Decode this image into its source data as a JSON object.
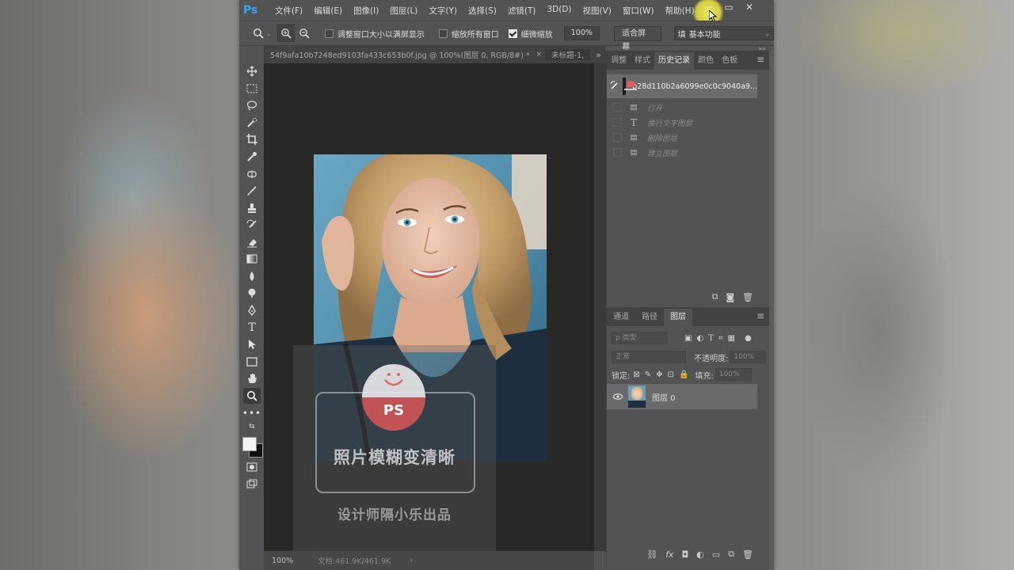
{
  "app": {
    "logo": "Ps",
    "menu": [
      "文件(F)",
      "编辑(E)",
      "图像(I)",
      "图层(L)",
      "文字(Y)",
      "选择(S)",
      "滤镜(T)",
      "3D(D)",
      "视图(V)",
      "窗口(W)",
      "帮助(H)"
    ],
    "window_controls": [
      "—",
      "▭",
      "✕"
    ]
  },
  "options": {
    "resize_windows_label": "调整窗口大小以满屏显示",
    "zoom_all_label": "缩放所有窗口",
    "scrubby_zoom_label": "细微缩放",
    "zoom_value": "100%",
    "fit_screen_button": "适合屏幕",
    "workspace_prefix": "填",
    "workspace_value": "基本功能",
    "resize_windows_checked": false,
    "zoom_all_checked": false,
    "scrubby_zoom_checked": true
  },
  "document": {
    "tab_title": "54f9afa10b7248ed9103fa433c653b0f.jpg @ 100%(图层 0, RGB/8#) *",
    "tab_close": "×",
    "second_tab": "未标题-1,",
    "overflow": "»",
    "zoom_status": "100%",
    "doc_status": "文档:461.9K/461.9K"
  },
  "watermark": {
    "badge_text": "PS",
    "title": "照片模糊变清晰",
    "subtitle": "设计师隔小乐出品"
  },
  "history_panel": {
    "tabs": [
      "调整",
      "样式",
      "历史记录",
      "颜色",
      "色板"
    ],
    "active_tab": 2,
    "snapshot_label": "b28d110b2a6099e0c0c9040a9...",
    "items": [
      {
        "icon": "document-icon",
        "label": "打开"
      },
      {
        "icon": "text-icon",
        "label": "换行文字图层"
      },
      {
        "icon": "document-icon",
        "label": "删除图层"
      },
      {
        "icon": "document-icon",
        "label": "建立图层"
      }
    ]
  },
  "layers_panel": {
    "tabs": [
      "通道",
      "路径",
      "图层"
    ],
    "active_tab": 2,
    "filter_placeholder": "ρ 类型",
    "blend_mode": "正常",
    "opacity_label": "不透明度:",
    "opacity_value": "100%",
    "lock_label": "锁定:",
    "fill_label": "填充:",
    "fill_value": "100%",
    "layer_name": "图层 0"
  },
  "colors": {
    "ps_blue": "#31a8ff",
    "panel_bg": "#535353",
    "canvas_bg": "#282826",
    "highlight": "#6b6b6b"
  }
}
